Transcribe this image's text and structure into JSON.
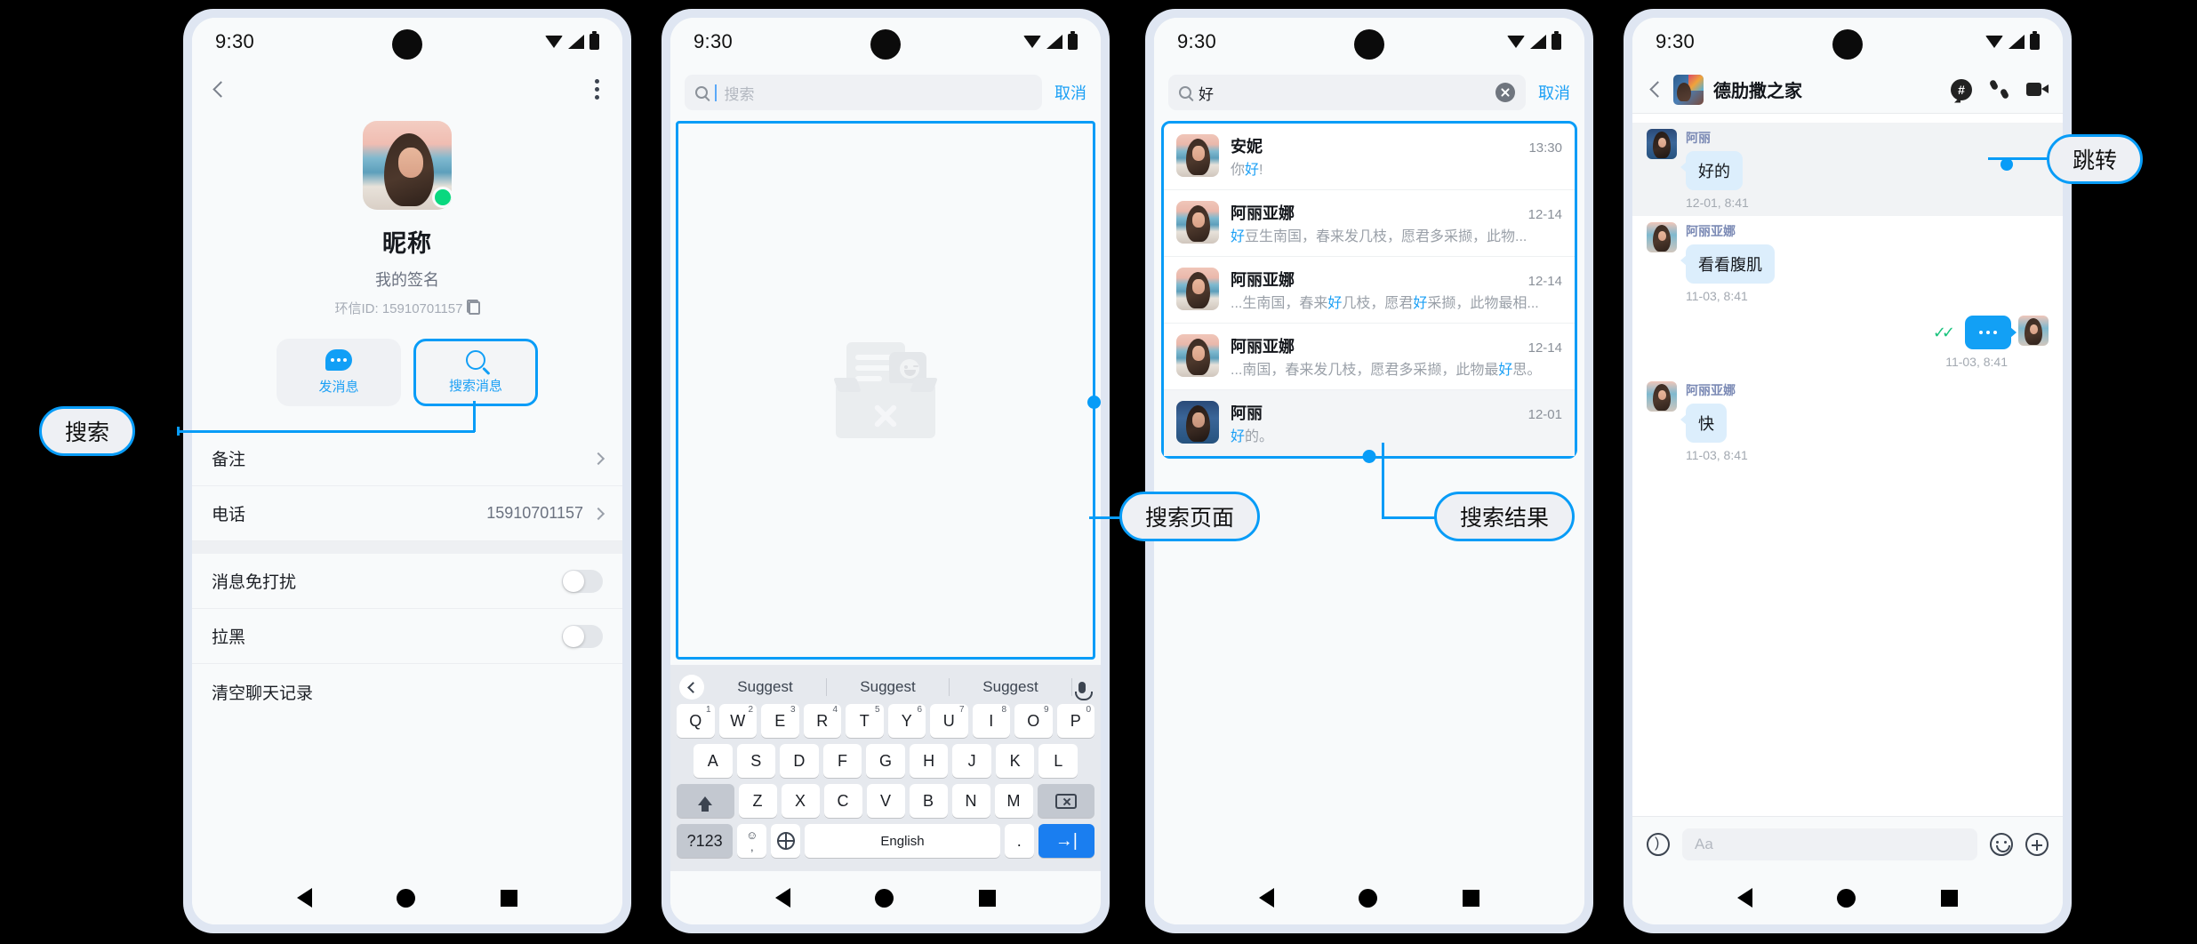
{
  "status_bar": {
    "time": "9:30",
    "icons": [
      "wifi-icon",
      "signal-icon",
      "battery-icon"
    ]
  },
  "accent_color": "#089cf7",
  "phone1_profile": {
    "back_icon": "chevron-left-icon",
    "menu_icon": "kebab-menu-icon",
    "name": "昵称",
    "signature": "我的签名",
    "id_label": "环信ID: 15910701157",
    "copy_icon": "copy-icon",
    "actions": [
      {
        "label": "发消息",
        "icon": "chat-bubble-icon"
      },
      {
        "label": "搜索消息",
        "icon": "search-icon"
      }
    ],
    "rows": [
      {
        "label": "备注",
        "value": "",
        "type": "chevron"
      },
      {
        "label": "电话",
        "value": "15910701157",
        "type": "chevron"
      },
      {
        "label": "消息免打扰",
        "value": "",
        "type": "toggle"
      },
      {
        "label": "拉黑",
        "value": "",
        "type": "toggle"
      },
      {
        "label": "清空聊天记录",
        "value": "",
        "type": "plain"
      }
    ]
  },
  "phone2_search": {
    "placeholder": "搜索",
    "cancel": "取消",
    "empty_illustration": "empty-box-icon",
    "keyboard": {
      "suggestions": [
        "Suggest",
        "Suggest",
        "Suggest"
      ],
      "mic_icon": "microphone-icon",
      "row1": [
        {
          "k": "Q",
          "n": "1"
        },
        {
          "k": "W",
          "n": "2"
        },
        {
          "k": "E",
          "n": "3"
        },
        {
          "k": "R",
          "n": "4"
        },
        {
          "k": "T",
          "n": "5"
        },
        {
          "k": "Y",
          "n": "6"
        },
        {
          "k": "U",
          "n": "7"
        },
        {
          "k": "I",
          "n": "8"
        },
        {
          "k": "O",
          "n": "9"
        },
        {
          "k": "P",
          "n": "0"
        }
      ],
      "row2": [
        "A",
        "S",
        "D",
        "F",
        "G",
        "H",
        "J",
        "K",
        "L"
      ],
      "row3": [
        "Z",
        "X",
        "C",
        "V",
        "B",
        "N",
        "M"
      ],
      "numbers_key": "?123",
      "emoji_key_top": "☺",
      "emoji_key_bottom": ",",
      "space_key": "English",
      "period_key": ".",
      "enter_key": "→|",
      "shift_icon": "shift-icon",
      "backspace_icon": "backspace-icon",
      "globe_icon": "globe-icon"
    }
  },
  "phone3_results": {
    "query": "好",
    "cancel": "取消",
    "clear_icon": "clear-circle-icon",
    "items": [
      {
        "name": "安妮",
        "time": "13:30",
        "parts": [
          {
            "t": "你",
            "h": false
          },
          {
            "t": "好",
            "h": true
          },
          {
            "t": "!",
            "h": false
          }
        ]
      },
      {
        "name": "阿丽亚娜",
        "time": "12-14",
        "parts": [
          {
            "t": "好",
            "h": true
          },
          {
            "t": "豆生南国，春来发几枝，愿君多采撷，此物...",
            "h": false
          }
        ]
      },
      {
        "name": "阿丽亚娜",
        "time": "12-14",
        "parts": [
          {
            "t": "...生南国，春来",
            "h": false
          },
          {
            "t": "好",
            "h": true
          },
          {
            "t": "几枝，愿君",
            "h": false
          },
          {
            "t": "好",
            "h": true
          },
          {
            "t": "采撷，此物最相...",
            "h": false
          }
        ]
      },
      {
        "name": "阿丽亚娜",
        "time": "12-14",
        "parts": [
          {
            "t": "...南国，春来发几枝，愿君多采撷，此物最",
            "h": false
          },
          {
            "t": "好",
            "h": true
          },
          {
            "t": "思。",
            "h": false
          }
        ]
      },
      {
        "name": "阿丽",
        "time": "12-01",
        "shaded": true,
        "parts": [
          {
            "t": "好",
            "h": true
          },
          {
            "t": "的。",
            "h": false
          }
        ]
      }
    ]
  },
  "phone4_chat": {
    "back_icon": "chevron-left-icon",
    "title": "德肋撒之家",
    "header_icons": [
      "hashtag-icon",
      "phone-icon",
      "video-camera-icon"
    ],
    "messages": [
      {
        "dir": "in",
        "sender": "阿丽",
        "text": "好的",
        "time": "12-01, 8:41",
        "focused": true
      },
      {
        "dir": "in",
        "sender": "阿丽亚娜",
        "text": "看看腹肌",
        "time": "11-03, 8:41"
      },
      {
        "dir": "out",
        "text": "...",
        "time": "11-03, 8:41",
        "status_icon": "double-check-icon"
      },
      {
        "dir": "in",
        "sender": "阿丽亚娜",
        "text": "快",
        "time": "11-03, 8:41"
      }
    ],
    "input": {
      "voice_icon": "voice-icon",
      "placeholder": "Aa",
      "emoji_icon": "emoji-icon",
      "plus_icon": "plus-icon"
    }
  },
  "nav_bar": {
    "back": "nav-back-icon",
    "home": "nav-home-icon",
    "recent": "nav-recent-icon"
  },
  "callouts": [
    {
      "label": "搜索"
    },
    {
      "label": "搜索页面"
    },
    {
      "label": "搜索结果"
    },
    {
      "label": "跳转"
    }
  ]
}
